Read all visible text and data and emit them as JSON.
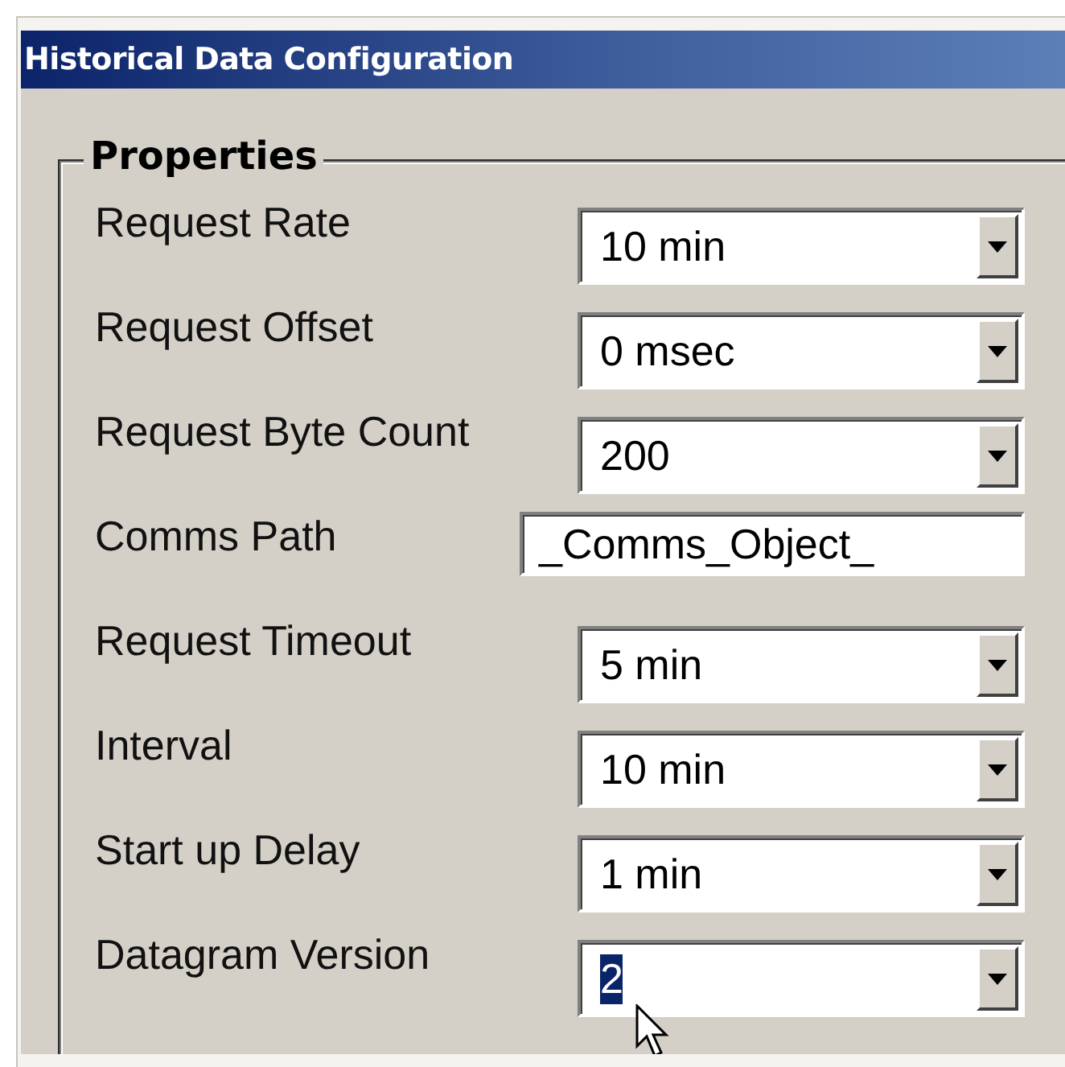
{
  "window": {
    "title": "Historical Data Configuration"
  },
  "group": {
    "title": "Properties"
  },
  "fields": [
    {
      "label": "Request Rate",
      "kind": "combo",
      "value": "10 min",
      "text_selected": false
    },
    {
      "label": "Request Offset",
      "kind": "combo",
      "value": "0 msec",
      "text_selected": false
    },
    {
      "label": "Request Byte Count",
      "kind": "combo",
      "value": "200",
      "text_selected": false
    },
    {
      "label": "Comms Path",
      "kind": "text",
      "value": "_Comms_Object_",
      "text_selected": false
    },
    {
      "label": "Request Timeout",
      "kind": "combo",
      "value": "5 min",
      "text_selected": false
    },
    {
      "label": "Interval",
      "kind": "combo",
      "value": "10 min",
      "text_selected": false
    },
    {
      "label": "Start up Delay",
      "kind": "combo",
      "value": "1 min",
      "text_selected": false
    },
    {
      "label": "Datagram Version",
      "kind": "combo",
      "value": "2",
      "text_selected": true
    }
  ]
}
